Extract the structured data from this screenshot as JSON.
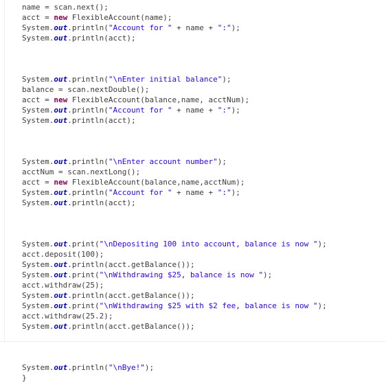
{
  "document": {
    "kind": "java-source-listing",
    "language": "Java",
    "background_color": "#ffffff",
    "colors": {
      "default_text": "#3f3a38",
      "keyword": "#7f0055",
      "static_field": "#0000c0",
      "string_literal": "#2a00ff",
      "rule": "#eceef0"
    }
  },
  "code": {
    "lines": [
      {
        "id": 1,
        "tokens": [
          {
            "t": "plain",
            "v": "name = scan.next();"
          }
        ]
      },
      {
        "id": 2,
        "tokens": [
          {
            "t": "plain",
            "v": "acct = "
          },
          {
            "t": "keyword",
            "v": "new"
          },
          {
            "t": "plain",
            "v": " FlexibleAccount(name);"
          }
        ]
      },
      {
        "id": 3,
        "tokens": [
          {
            "t": "plain",
            "v": "System."
          },
          {
            "t": "field",
            "v": "out"
          },
          {
            "t": "plain",
            "v": ".println("
          },
          {
            "t": "string",
            "v": "\"Account for \""
          },
          {
            "t": "plain",
            "v": " + name + "
          },
          {
            "t": "string",
            "v": "\":\""
          },
          {
            "t": "plain",
            "v": ");"
          }
        ]
      },
      {
        "id": 4,
        "tokens": [
          {
            "t": "plain",
            "v": "System."
          },
          {
            "t": "field",
            "v": "out"
          },
          {
            "t": "plain",
            "v": ".println(acct);"
          }
        ]
      },
      {
        "id": 5,
        "tokens": []
      },
      {
        "id": 6,
        "tokens": []
      },
      {
        "id": 7,
        "tokens": []
      },
      {
        "id": 8,
        "tokens": [
          {
            "t": "plain",
            "v": "System."
          },
          {
            "t": "field",
            "v": "out"
          },
          {
            "t": "plain",
            "v": ".println("
          },
          {
            "t": "string",
            "v": "\"\\nEnter initial balance\""
          },
          {
            "t": "plain",
            "v": ");"
          }
        ]
      },
      {
        "id": 9,
        "tokens": [
          {
            "t": "plain",
            "v": "balance = scan.nextDouble();"
          }
        ]
      },
      {
        "id": 10,
        "tokens": [
          {
            "t": "plain",
            "v": "acct = "
          },
          {
            "t": "keyword",
            "v": "new"
          },
          {
            "t": "plain",
            "v": " FlexibleAccount(balance,name, acctNum);"
          }
        ]
      },
      {
        "id": 11,
        "tokens": [
          {
            "t": "plain",
            "v": "System."
          },
          {
            "t": "field",
            "v": "out"
          },
          {
            "t": "plain",
            "v": ".println("
          },
          {
            "t": "string",
            "v": "\"Account for \""
          },
          {
            "t": "plain",
            "v": " + name + "
          },
          {
            "t": "string",
            "v": "\":\""
          },
          {
            "t": "plain",
            "v": ");"
          }
        ]
      },
      {
        "id": 12,
        "tokens": [
          {
            "t": "plain",
            "v": "System."
          },
          {
            "t": "field",
            "v": "out"
          },
          {
            "t": "plain",
            "v": ".println(acct);"
          }
        ]
      },
      {
        "id": 13,
        "tokens": []
      },
      {
        "id": 14,
        "tokens": []
      },
      {
        "id": 15,
        "tokens": []
      },
      {
        "id": 16,
        "tokens": [
          {
            "t": "plain",
            "v": "System."
          },
          {
            "t": "field",
            "v": "out"
          },
          {
            "t": "plain",
            "v": ".println("
          },
          {
            "t": "string",
            "v": "\"\\nEnter account number\""
          },
          {
            "t": "plain",
            "v": ");"
          }
        ]
      },
      {
        "id": 17,
        "tokens": [
          {
            "t": "plain",
            "v": "acctNum = scan.nextLong();"
          }
        ]
      },
      {
        "id": 18,
        "tokens": [
          {
            "t": "plain",
            "v": "acct = "
          },
          {
            "t": "keyword",
            "v": "new"
          },
          {
            "t": "plain",
            "v": " FlexibleAccount(balance,name,acctNum);"
          }
        ]
      },
      {
        "id": 19,
        "tokens": [
          {
            "t": "plain",
            "v": "System."
          },
          {
            "t": "field",
            "v": "out"
          },
          {
            "t": "plain",
            "v": ".println("
          },
          {
            "t": "string",
            "v": "\"Account for \""
          },
          {
            "t": "plain",
            "v": " + name + "
          },
          {
            "t": "string",
            "v": "\":\""
          },
          {
            "t": "plain",
            "v": ");"
          }
        ]
      },
      {
        "id": 20,
        "tokens": [
          {
            "t": "plain",
            "v": "System."
          },
          {
            "t": "field",
            "v": "out"
          },
          {
            "t": "plain",
            "v": ".println(acct);"
          }
        ]
      },
      {
        "id": 21,
        "tokens": []
      },
      {
        "id": 22,
        "tokens": []
      },
      {
        "id": 23,
        "tokens": []
      },
      {
        "id": 24,
        "tokens": [
          {
            "t": "plain",
            "v": "System."
          },
          {
            "t": "field",
            "v": "out"
          },
          {
            "t": "plain",
            "v": ".print("
          },
          {
            "t": "string",
            "v": "\"\\nDepositing 100 into account, balance is now \""
          },
          {
            "t": "plain",
            "v": ");"
          }
        ]
      },
      {
        "id": 25,
        "tokens": [
          {
            "t": "plain",
            "v": "acct.deposit(100);"
          }
        ]
      },
      {
        "id": 26,
        "tokens": [
          {
            "t": "plain",
            "v": "System."
          },
          {
            "t": "field",
            "v": "out"
          },
          {
            "t": "plain",
            "v": ".println(acct.getBalance());"
          }
        ]
      },
      {
        "id": 27,
        "tokens": [
          {
            "t": "plain",
            "v": "System."
          },
          {
            "t": "field",
            "v": "out"
          },
          {
            "t": "plain",
            "v": ".print("
          },
          {
            "t": "string",
            "v": "\"\\nWithdrawing $25, balance is now \""
          },
          {
            "t": "plain",
            "v": ");"
          }
        ]
      },
      {
        "id": 28,
        "tokens": [
          {
            "t": "plain",
            "v": "acct.withdraw(25);"
          }
        ]
      },
      {
        "id": 29,
        "tokens": [
          {
            "t": "plain",
            "v": "System."
          },
          {
            "t": "field",
            "v": "out"
          },
          {
            "t": "plain",
            "v": ".println(acct.getBalance());"
          }
        ]
      },
      {
        "id": 30,
        "tokens": [
          {
            "t": "plain",
            "v": "System."
          },
          {
            "t": "field",
            "v": "out"
          },
          {
            "t": "plain",
            "v": ".print("
          },
          {
            "t": "string",
            "v": "\"\\nWithdrawing $25 with $2 fee, balance is now \""
          },
          {
            "t": "plain",
            "v": ");"
          }
        ]
      },
      {
        "id": 31,
        "tokens": [
          {
            "t": "plain",
            "v": "acct.withdraw(25.2);"
          }
        ]
      },
      {
        "id": 32,
        "tokens": [
          {
            "t": "plain",
            "v": "System."
          },
          {
            "t": "field",
            "v": "out"
          },
          {
            "t": "plain",
            "v": ".println(acct.getBalance());"
          }
        ]
      },
      {
        "id": 33,
        "tokens": []
      },
      {
        "id": 34,
        "tokens": []
      },
      {
        "id": 35,
        "tokens": []
      },
      {
        "id": 36,
        "tokens": [
          {
            "t": "plain",
            "v": "System."
          },
          {
            "t": "field",
            "v": "out"
          },
          {
            "t": "plain",
            "v": ".println("
          },
          {
            "t": "string",
            "v": "\"\\nBye!\""
          },
          {
            "t": "plain",
            "v": ");"
          }
        ]
      },
      {
        "id": 37,
        "tokens": [
          {
            "t": "plain",
            "v": "}"
          }
        ]
      }
    ]
  }
}
